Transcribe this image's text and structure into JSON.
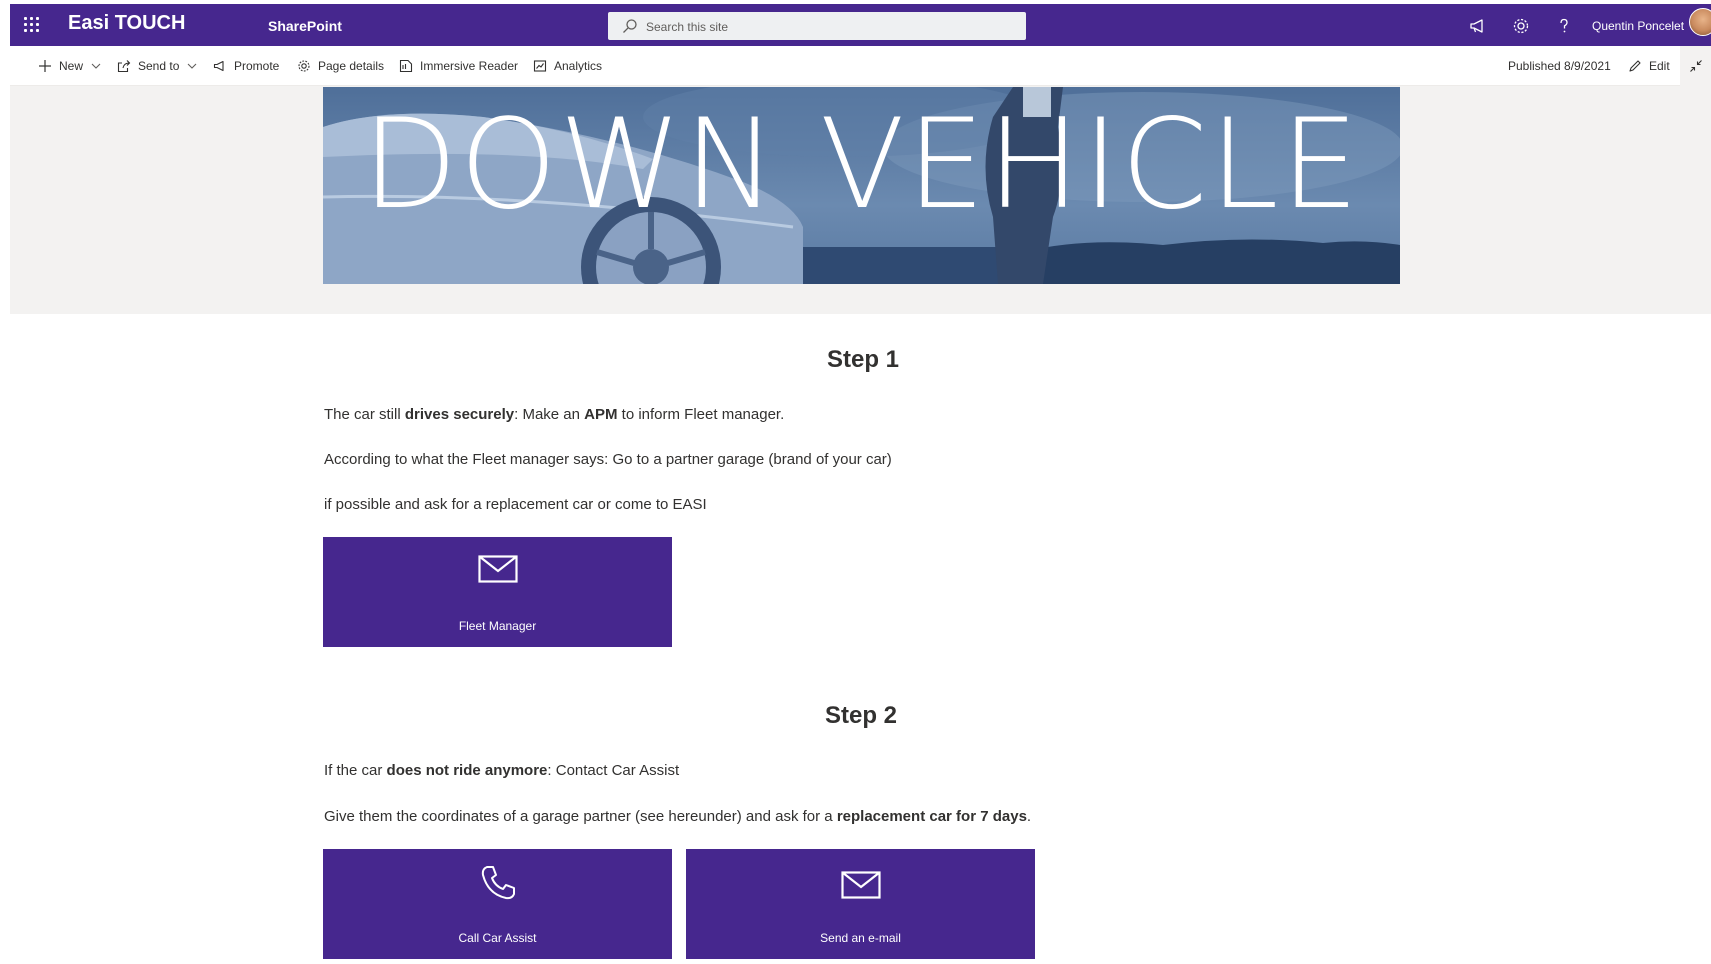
{
  "suite": {
    "site_title": "Easi TOUCH",
    "product": "SharePoint",
    "search_placeholder": "Search this site",
    "user_name": "Quentin Poncelet",
    "brand_color": "#46278e",
    "icons": [
      "app-launcher-icon",
      "megaphone-icon",
      "gear-icon",
      "help-icon"
    ]
  },
  "commands": {
    "new": "New",
    "send_to": "Send to",
    "promote": "Promote",
    "page_details": "Page details",
    "immersive_reader": "Immersive Reader",
    "analytics": "Analytics",
    "published": "Published 8/9/2021",
    "edit": "Edit"
  },
  "hero": {
    "title": "DOWN VEHICLE"
  },
  "step1": {
    "heading": "Step 1",
    "p1": {
      "a": "The car still ",
      "b": "drives securely",
      "c": ": Make an ",
      "d": "APM",
      "e": " to inform Fleet manager."
    },
    "p2": "According to what the Fleet manager says: Go to a partner garage (brand of your car)",
    "p3": "if possible and ask for a replacement car or come to EASI",
    "tile_label": "Fleet Manager"
  },
  "step2": {
    "heading": "Step 2",
    "p1": {
      "a": "If the car ",
      "b": "does not ride anymore",
      "c": ": Contact Car Assist"
    },
    "p2": {
      "a": "Give them the coordinates of a garage partner (see hereunder) and ask for a ",
      "b": "replacement car for 7 days",
      "c": "."
    },
    "tile_call_label": "Call Car Assist",
    "tile_mail_label": "Send an e-mail"
  }
}
